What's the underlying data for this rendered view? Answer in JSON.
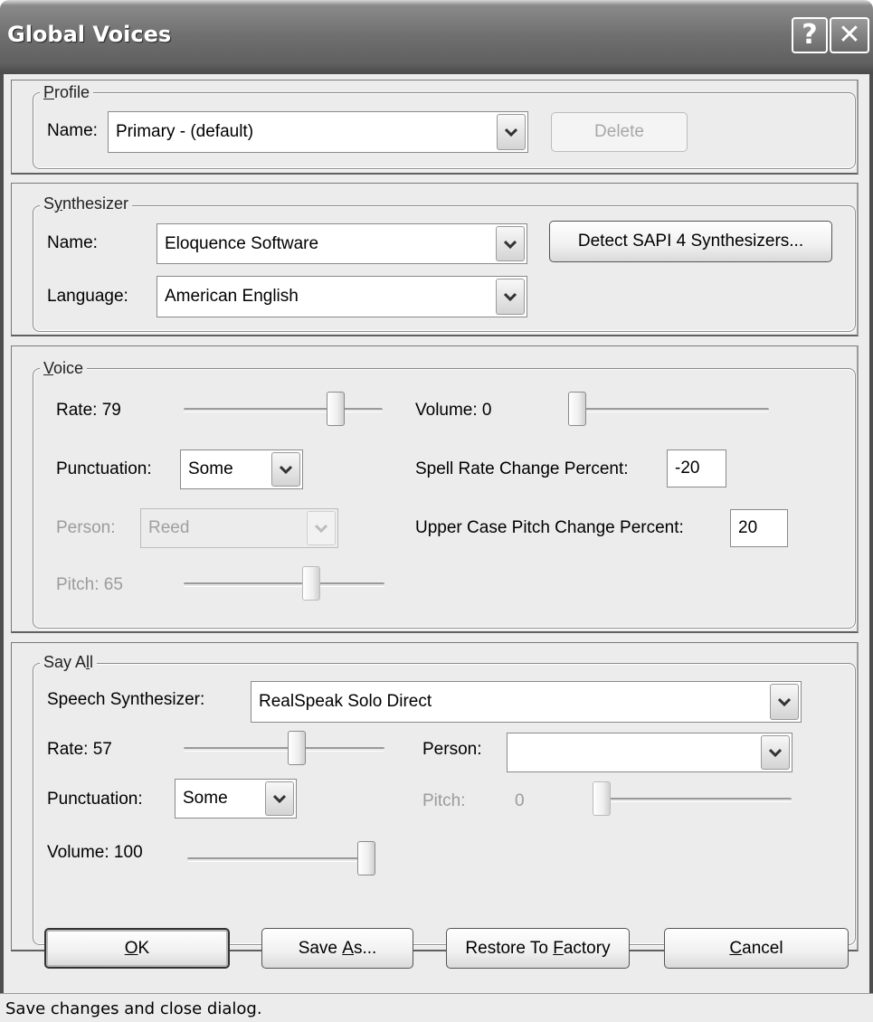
{
  "window": {
    "title": "Global Voices",
    "help_button": "?",
    "close_button": "✕"
  },
  "profile": {
    "legend_pre": "",
    "legend_ul": "P",
    "legend_post": "rofile",
    "name_label": "Name:",
    "name_value": "Primary - (default)",
    "delete_label": "Delete"
  },
  "synthesizer": {
    "legend_pre": "S",
    "legend_ul": "y",
    "legend_post": "nthesizer",
    "name_label": "Name:",
    "name_value": "Eloquence Software",
    "language_label": "Language:",
    "language_value": "American English",
    "detect_label": "Detect SAPI 4 Synthesizers..."
  },
  "voice": {
    "legend_pre": "",
    "legend_ul": "V",
    "legend_post": "oice",
    "rate_label": "Rate: 79",
    "rate_value": 79,
    "volume_label": "Volume:  0",
    "volume_value": 0,
    "punctuation_label": "Punctuation:",
    "punctuation_value": "Some",
    "spell_rate_label": "Spell Rate Change Percent:",
    "spell_rate_value": "-20",
    "person_label": "Person:",
    "person_value": "Reed",
    "upper_case_label": "Upper Case Pitch Change Percent:",
    "upper_case_value": "20",
    "pitch_label": "Pitch:  65",
    "pitch_value": 65
  },
  "say_all": {
    "legend_pre": "Say A",
    "legend_ul": "l",
    "legend_post": "l",
    "synth_label": "Speech Synthesizer:",
    "synth_value": "RealSpeak Solo Direct",
    "rate_label": "Rate:  57",
    "rate_value": 57,
    "person_label": "Person:",
    "person_value": "",
    "punctuation_label": "Punctuation:",
    "punctuation_value": "Some",
    "pitch_label": "Pitch:",
    "pitch_number": "0",
    "pitch_value": 0,
    "volume_label": "Volume: 100",
    "volume_value": 100
  },
  "buttons": {
    "ok_ul": "O",
    "ok_post": "K",
    "save_as_pre": "Save ",
    "save_as_ul": "A",
    "save_as_post": "s...",
    "restore_pre": "Restore To ",
    "restore_ul": "F",
    "restore_post": "actory",
    "cancel_ul": "C",
    "cancel_post": "ancel"
  },
  "status": {
    "text": "Save changes and close dialog."
  }
}
